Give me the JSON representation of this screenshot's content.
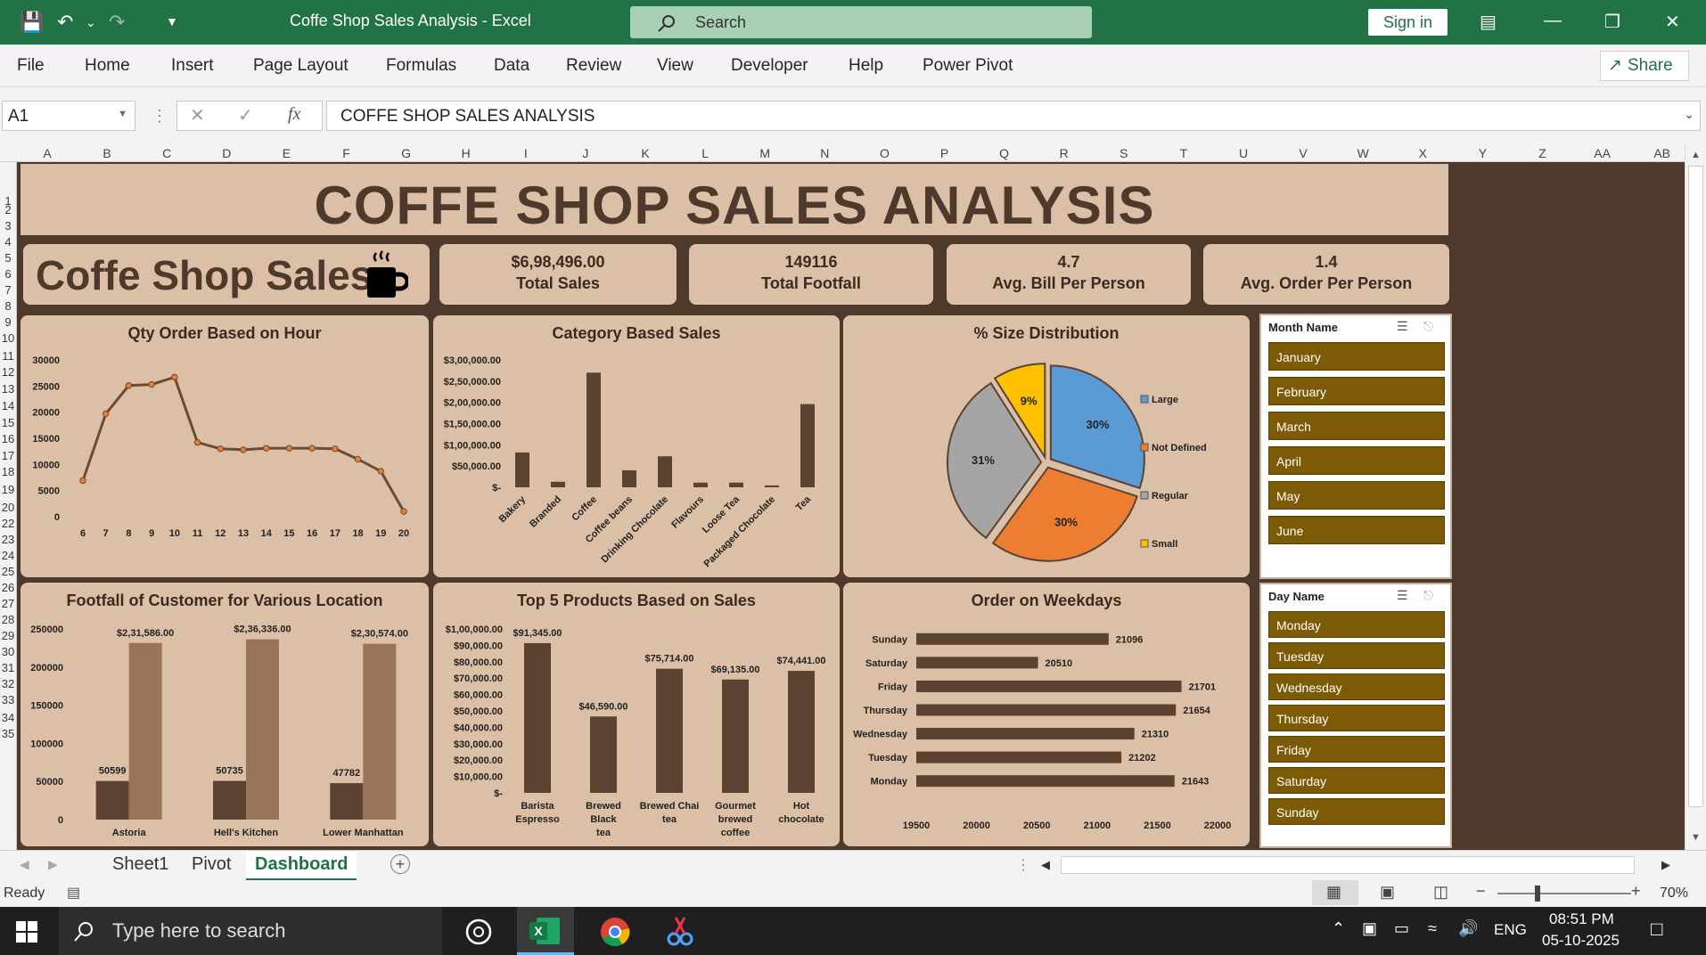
{
  "window": {
    "doc_title": "Coffe Shop Sales Analysis  -  Excel",
    "search_placeholder": "Search",
    "sign_in": "Sign in"
  },
  "menu": [
    "File",
    "Home",
    "Insert",
    "Page Layout",
    "Formulas",
    "Data",
    "Review",
    "View",
    "Developer",
    "Help",
    "Power Pivot"
  ],
  "share_label": "Share",
  "formula_bar": {
    "name_box": "A1",
    "formula": "COFFE SHOP SALES ANALYSIS"
  },
  "columns": [
    "A",
    "B",
    "C",
    "D",
    "E",
    "F",
    "G",
    "H",
    "I",
    "J",
    "K",
    "L",
    "M",
    "N",
    "O",
    "P",
    "Q",
    "R",
    "S",
    "T",
    "U",
    "V",
    "W",
    "X",
    "Y",
    "Z",
    "AA",
    "AB"
  ],
  "rows": [
    "1",
    "2",
    "3",
    "4",
    "5",
    "6",
    "7",
    "8",
    "9",
    "10",
    "11",
    "12",
    "13",
    "14",
    "15",
    "16",
    "17",
    "18",
    "19",
    "20",
    "22",
    "23",
    "24",
    "25",
    "26",
    "27",
    "28",
    "29",
    "30",
    "31",
    "32",
    "33",
    "34",
    "35"
  ],
  "dashboard": {
    "title": "COFFE SHOP SALES ANALYSIS",
    "brand": "Coffe Shop Sales",
    "kpis": [
      {
        "value": "$6,98,496.00",
        "label": "Total Sales"
      },
      {
        "value": "149116",
        "label": "Total Footfall"
      },
      {
        "value": "4.7",
        "label": "Avg. Bill Per Person"
      },
      {
        "value": "1.4",
        "label": "Avg. Order Per Person"
      }
    ]
  },
  "chart_titles": {
    "hour": "Qty Order Based on Hour",
    "category": "Category Based Sales",
    "size": "% Size Distribution",
    "footfall": "Footfall of Customer for Various Location",
    "top5": "Top 5 Products Based on Sales",
    "weekday": "Order on Weekdays"
  },
  "chart_data": [
    {
      "type": "line",
      "title": "Qty Order Based on Hour",
      "x": [
        6,
        7,
        8,
        9,
        10,
        11,
        12,
        13,
        14,
        15,
        16,
        17,
        18,
        19,
        20
      ],
      "values": [
        6900,
        19700,
        25100,
        25300,
        26700,
        14200,
        13000,
        12800,
        13100,
        13100,
        13100,
        13000,
        11000,
        8700,
        1000
      ],
      "ylim": [
        0,
        30000
      ],
      "yticks": [
        "30000",
        "25000",
        "20000",
        "15000",
        "10000",
        "5000",
        "0"
      ]
    },
    {
      "type": "bar",
      "title": "Category Based Sales",
      "categories": [
        "Bakery",
        "Branded",
        "Coffee",
        "Coffee beans",
        "Drinking Chocolate",
        "Flavours",
        "Loose Tea",
        "Packaged Chocolate",
        "Tea"
      ],
      "values": [
        82000,
        13000,
        270000,
        40000,
        73000,
        11000,
        11000,
        4400,
        196000
      ],
      "ylim": [
        0,
        300000
      ],
      "yticks": [
        "$3,00,000.00",
        "$2,50,000.00",
        "$2,00,000.00",
        "$1,50,000.00",
        "$1,00,000.00",
        "$50,000.00",
        "$-"
      ]
    },
    {
      "type": "pie",
      "title": "% Size Distribution",
      "labels": [
        "Large",
        "Not Defined",
        "Regular",
        "Small"
      ],
      "values": [
        30,
        30,
        31,
        9
      ],
      "value_labels": [
        "30%",
        "30%",
        "31%",
        "9%"
      ],
      "colors": [
        "#5b9bd5",
        "#ed7d31",
        "#a5a5a5",
        "#ffc000"
      ]
    },
    {
      "type": "bar",
      "title": "Footfall of Customer for Various Location",
      "categories": [
        "Astoria",
        "Hell's Kitchen",
        "Lower Manhattan"
      ],
      "series": [
        {
          "values": [
            50599,
            50735,
            47782
          ],
          "labels": [
            "50599",
            "50735",
            "47782"
          ],
          "color": "#5c4230"
        },
        {
          "values": [
            231586,
            236336,
            230574
          ],
          "labels": [
            "$2,31,586.00",
            "$2,36,336.00",
            "$2,30,574.00"
          ],
          "color": "#9a7458"
        }
      ],
      "ylim": [
        0,
        250000
      ],
      "yticks": [
        "250000",
        "200000",
        "150000",
        "100000",
        "50000",
        "0"
      ]
    },
    {
      "type": "bar",
      "title": "Top 5 Products Based on Sales",
      "categories": [
        "Barista Espresso",
        "Brewed Black tea",
        "Brewed Chai tea",
        "Gourmet brewed coffee",
        "Hot chocolate"
      ],
      "values": [
        91345,
        46590,
        75714,
        69135,
        74441
      ],
      "value_labels": [
        "$91,345.00",
        "$46,590.00",
        "$75,714.00",
        "$69,135.00",
        "$74,441.00"
      ],
      "ylim": [
        0,
        100000
      ],
      "yticks": [
        "$1,00,000.00",
        "$90,000.00",
        "$80,000.00",
        "$70,000.00",
        "$60,000.00",
        "$50,000.00",
        "$40,000.00",
        "$30,000.00",
        "$20,000.00",
        "$10,000.00",
        "$-"
      ]
    },
    {
      "type": "bar",
      "title": "Order on Weekdays",
      "orientation": "horizontal",
      "categories": [
        "Sunday",
        "Saturday",
        "Friday",
        "Thursday",
        "Wednesday",
        "Tuesday",
        "Monday"
      ],
      "values": [
        21096,
        20510,
        21701,
        21654,
        21310,
        21202,
        21643
      ],
      "xlim": [
        19500,
        22000
      ],
      "xticks": [
        "19500",
        "20000",
        "20500",
        "21000",
        "21500",
        "22000"
      ]
    }
  ],
  "slicers": {
    "month": {
      "title": "Month Name",
      "items": [
        "January",
        "February",
        "March",
        "April",
        "May",
        "June"
      ]
    },
    "day": {
      "title": "Day Name",
      "items": [
        "Monday",
        "Tuesday",
        "Wednesday",
        "Thursday",
        "Friday",
        "Saturday",
        "Sunday"
      ]
    }
  },
  "sheet_tabs": [
    "Sheet1",
    "Pivot",
    "Dashboard"
  ],
  "active_tab": "Dashboard",
  "status": {
    "ready": "Ready",
    "zoom": "70%"
  },
  "taskbar": {
    "search_placeholder": "Type here to search",
    "lang": "ENG",
    "time": "08:51 PM",
    "date": "05-10-2025"
  },
  "colors": {
    "excel_green": "#217346",
    "dashboard_bg": "#4d3a2c",
    "card_bg": "#dcbfa7",
    "bar_dark": "#5c4230",
    "slicer_item": "#7d5a05"
  }
}
